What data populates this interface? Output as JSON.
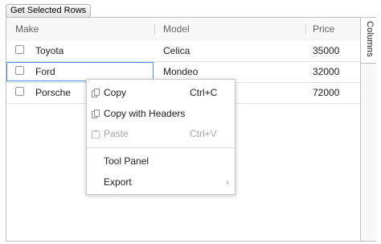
{
  "toolbar": {
    "get_selected_rows": "Get Selected Rows"
  },
  "grid": {
    "columns": [
      "Make",
      "Model",
      "Price"
    ],
    "rows": [
      {
        "make": "Toyota",
        "model": "Celica",
        "price": "35000"
      },
      {
        "make": "Ford",
        "model": "Mondeo",
        "price": "32000"
      },
      {
        "make": "Porsche",
        "model": "",
        "price": "72000"
      }
    ],
    "side_tab": "Columns"
  },
  "context_menu": {
    "items": [
      {
        "label": "Copy",
        "shortcut": "Ctrl+C",
        "icon": "copy-icon",
        "enabled": true
      },
      {
        "label": "Copy with Headers",
        "shortcut": "",
        "icon": "copy-icon",
        "enabled": true
      },
      {
        "label": "Paste",
        "shortcut": "Ctrl+V",
        "icon": "paste-icon",
        "enabled": false
      },
      {
        "label": "Tool Panel",
        "shortcut": "",
        "icon": "",
        "enabled": true
      },
      {
        "label": "Export",
        "shortcut": "",
        "icon": "chevron-right-icon",
        "enabled": true
      }
    ]
  }
}
